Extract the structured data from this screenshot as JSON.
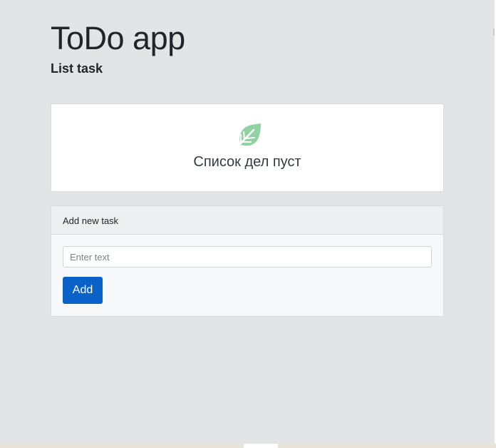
{
  "header": {
    "title": "ToDo app",
    "subtitle": "List task"
  },
  "empty_state": {
    "icon": "leaf-icon",
    "icon_color": "#8fd3a0",
    "message": "Список дел пуст"
  },
  "add_task": {
    "card_title": "Add new task",
    "input_value": "",
    "input_placeholder": "Enter text",
    "button_label": "Add",
    "button_color": "#0a62c9"
  }
}
